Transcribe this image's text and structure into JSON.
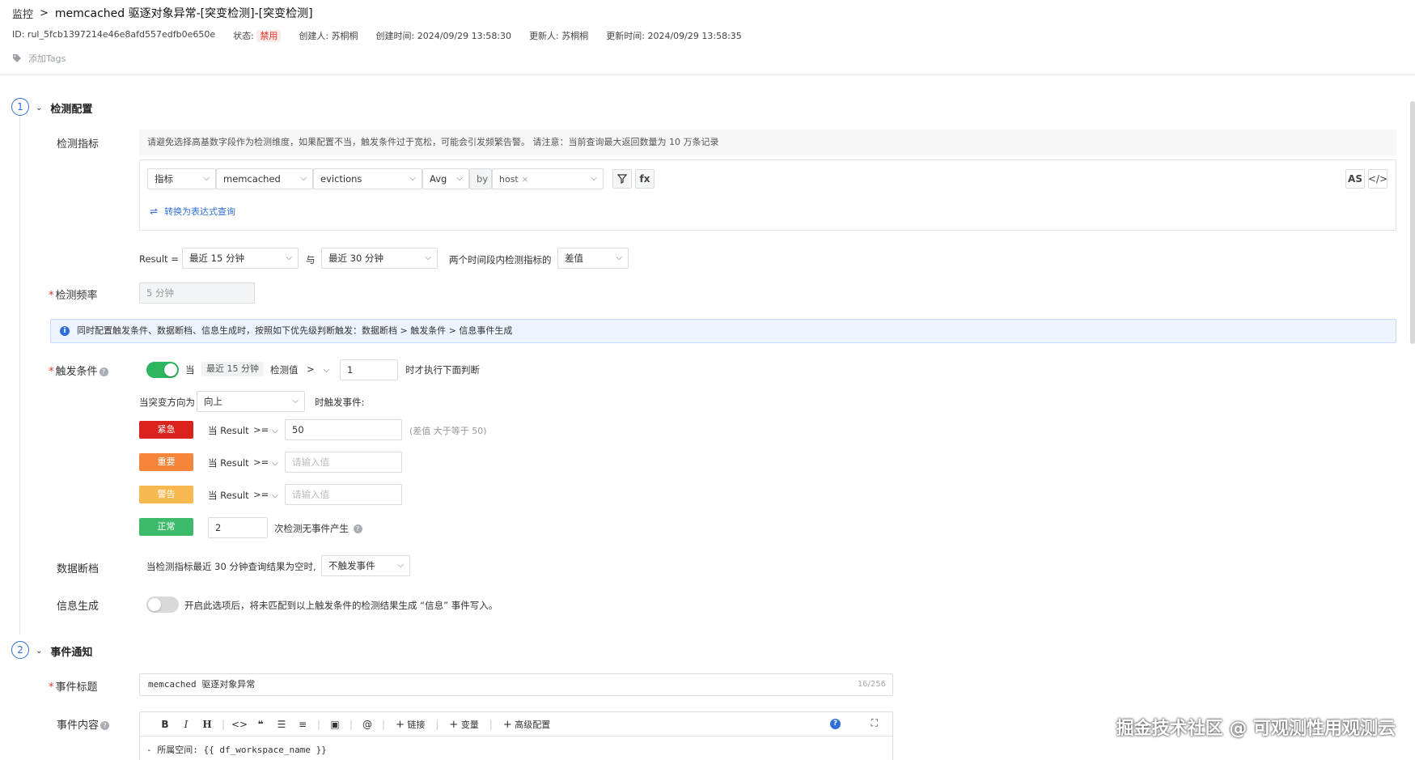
{
  "breadcrumb": {
    "root": "监控",
    "separator": ">",
    "title": "memcached 驱逐对象异常-[突变检测]-[突变检测]"
  },
  "meta": {
    "id": "ID: rul_5fcb1397214e46e8afd557edfb0e650e",
    "status_label": "状态:",
    "status_value": "禁用",
    "creator": "创建人: 苏桐桐",
    "created_time": "创建时间: 2024/09/29 13:58:30",
    "updater": "更新人: 苏桐桐",
    "updated_time": "更新时间: 2024/09/29 13:58:35"
  },
  "tags": {
    "icon": "tag-icon",
    "add_label": "添加Tags"
  },
  "section1": {
    "number": "1",
    "title": "检测配置",
    "metric_label": "检测指标",
    "hint": "请避免选择高基数字段作为检测维度，如果配置不当，触发条件过于宽松，可能会引发频繁告警。 请注意：当前查询最大返回数量为 10 万条记录",
    "query": {
      "type": "指标",
      "measurement": "memcached",
      "field": "evictions",
      "agg": "Avg",
      "by": "by",
      "group_tag": "host",
      "filter_icon": "filter-icon",
      "fx": "fx",
      "as": "AS",
      "code_icon": "code-icon",
      "convert_link": "转换为表达式查询"
    },
    "result": {
      "label": "Result =",
      "range1": "最近 15 分钟",
      "with": "与",
      "range2": "最近 30 分钟",
      "desc": "两个时间段内检测指标的",
      "method": "差值"
    },
    "freq_label": "检测频率",
    "freq_value": "5 分钟",
    "info": "同时配置触发条件、数据断档、信息生成时，按照如下优先级判断触发：数据断档 > 触发条件 > 信息事件生成",
    "trigger": {
      "label": "触发条件",
      "when": "当",
      "window": "最近 15 分钟",
      "check_value": "检测值",
      "op": ">",
      "threshold": "1",
      "then": "时才执行下面判断",
      "direction_label": "当突变方向为",
      "direction": "向上",
      "trigger_event": "时触发事件:",
      "levels": [
        {
          "name": "紧急",
          "color": "#d9231c",
          "cond": "当 Result",
          "op": ">=",
          "value": "50",
          "placeholder": "",
          "note": "(差值 大于等于 50)"
        },
        {
          "name": "重要",
          "color": "#f5853a",
          "cond": "当 Result",
          "op": ">=",
          "value": "",
          "placeholder": "请输入值",
          "note": ""
        },
        {
          "name": "警告",
          "color": "#f7b850",
          "cond": "当 Result",
          "op": ">=",
          "value": "",
          "placeholder": "请输入值",
          "note": ""
        }
      ],
      "normal": {
        "name": "正常",
        "color": "#3dbb6b",
        "count": "2",
        "text": "次检测无事件产生"
      }
    },
    "nodata": {
      "label": "数据断档",
      "text": "当检测指标最近 30 分钟查询结果为空时,",
      "option": "不触发事件"
    },
    "info_gen": {
      "label": "信息生成",
      "text": "开启此选项后，将未匹配到以上触发条件的检测结果生成 “信息” 事件写入。"
    }
  },
  "section2": {
    "number": "2",
    "title": "事件通知",
    "event_title_label": "事件标题",
    "event_title_value": "memcached 驱逐对象异常",
    "event_title_count": "16/256",
    "content_label": "事件内容",
    "toolbar": {
      "bold": "B",
      "italic": "I",
      "heading": "H",
      "link_btn": "链接",
      "var_btn": "变量",
      "advanced_btn": "高级配置"
    },
    "content_line": "- 所属空间: {{ df_workspace_name }}"
  },
  "footer_watermark": "掘金技术社区 @ 可观测性用观测云"
}
